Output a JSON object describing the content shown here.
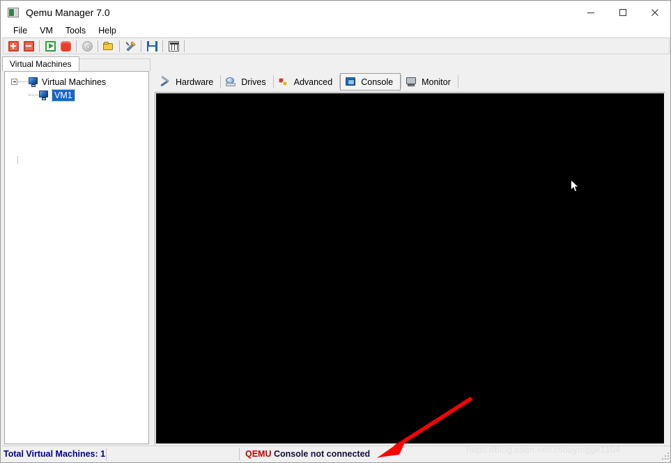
{
  "window": {
    "title": "Qemu Manager 7.0",
    "icon": "monitor-icon",
    "controls": {
      "minimize": "minimize-icon",
      "maximize": "maximize-icon",
      "close": "close-icon"
    }
  },
  "menu": {
    "items": [
      {
        "label": "File"
      },
      {
        "label": "VM"
      },
      {
        "label": "Tools"
      },
      {
        "label": "Help"
      }
    ]
  },
  "toolbar": {
    "buttons": [
      {
        "name": "add-vm-button",
        "icon": "add-box-icon"
      },
      {
        "name": "remove-vm-button",
        "icon": "remove-box-icon"
      },
      {
        "name": "start-vm-button",
        "icon": "play-icon"
      },
      {
        "name": "stop-vm-button",
        "icon": "stop-icon"
      },
      {
        "name": "cdrom-button",
        "icon": "cd-icon"
      },
      {
        "name": "open-folder-button",
        "icon": "folder-icon"
      },
      {
        "name": "tools-button",
        "icon": "wrench-screwdriver-icon"
      },
      {
        "name": "save-button",
        "icon": "floppy-disk-icon"
      },
      {
        "name": "settings-button",
        "icon": "sliders-icon"
      }
    ]
  },
  "left_panel": {
    "tab_label": "Virtual Machines",
    "tree": {
      "root": {
        "label": "Virtual Machines",
        "expanded": true
      },
      "children": [
        {
          "label": "VM1",
          "selected": true
        }
      ]
    }
  },
  "main_tabs": [
    {
      "label": "Hardware",
      "icon": "wrench-icon",
      "selected": false
    },
    {
      "label": "Drives",
      "icon": "disk-icon",
      "selected": false
    },
    {
      "label": "Advanced",
      "icon": "gears-icon",
      "selected": false
    },
    {
      "label": "Console",
      "icon": "console-icon",
      "selected": true
    },
    {
      "label": "Monitor",
      "icon": "computer-icon",
      "selected": false
    }
  ],
  "console": {
    "background_color": "#000000",
    "content": "",
    "cursor": "mouse-pointer"
  },
  "status_bar": {
    "total_vms": "Total Virtual Machines: 1",
    "connection_prefix": "QEMU",
    "connection_rest": " Console not connected"
  },
  "annotation": {
    "arrow_color": "#ff0000",
    "points_to": "QEMU Console not connected"
  },
  "watermark": {
    "text": "https://blog.csdn.net/zhouyingge1104"
  },
  "colors": {
    "title_bar": "#ffffff",
    "window_bg": "#f0f0f0",
    "selection_blue": "#1668c8",
    "status_text_blue": "#00008b",
    "status_text_red": "#c00000",
    "accent_red": "#ff0000"
  }
}
